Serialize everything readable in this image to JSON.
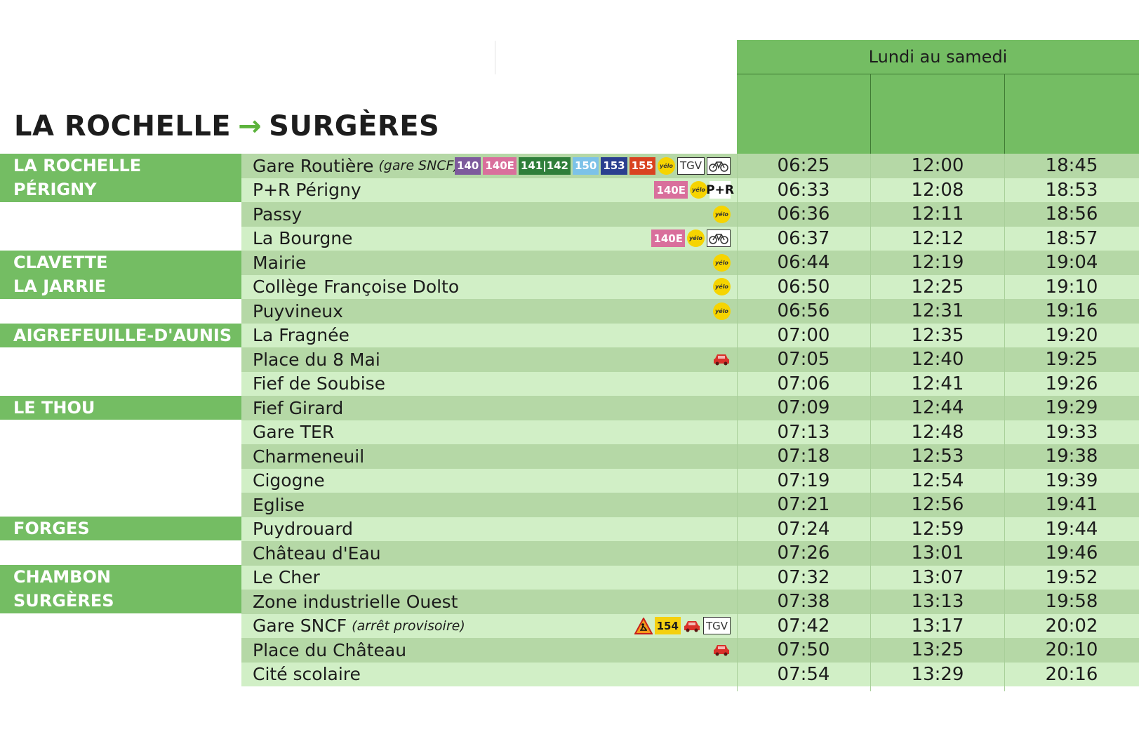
{
  "route": {
    "from": "LA ROCHELLE",
    "arrow": "→",
    "to": "SURGÈRES"
  },
  "header": {
    "days": "Lundi au samedi"
  },
  "communes": [
    {
      "label": "LA ROCHELLE"
    },
    {
      "label": "PÉRIGNY"
    },
    {
      "label": "CLAVETTE"
    },
    {
      "label": "LA JARRIE"
    },
    {
      "label": "AIGREFEUILLE-D'AUNIS"
    },
    {
      "label": "LE THOU"
    },
    {
      "label": "FORGES"
    },
    {
      "label": "CHAMBON"
    },
    {
      "label": "SURGÈRES"
    }
  ],
  "badges": {
    "l140": "140",
    "l140e": "140E",
    "l141": "141",
    "l142": "142",
    "l150": "150",
    "l153": "153",
    "l155": "155",
    "l154": "154",
    "tgv": "TGV",
    "yelo": "yélo",
    "pr": "P+R"
  },
  "icon_names": [
    "yelo-icon",
    "tgv-icon",
    "bike-icon",
    "park-and-ride-icon",
    "car-icon",
    "roadworks-icon"
  ],
  "colors": {
    "header_green": "#74bd63",
    "row_dark": "#b5d8a6",
    "row_light": "#d1efc6",
    "arrow_green": "#5cb33c"
  },
  "stops": [
    {
      "name": "Gare Routière",
      "note": "(gare SNCF)",
      "times": [
        "06:25",
        "12:00",
        "18:45"
      ]
    },
    {
      "name": "P+R Périgny",
      "times": [
        "06:33",
        "12:08",
        "18:53"
      ]
    },
    {
      "name": "Passy",
      "times": [
        "06:36",
        "12:11",
        "18:56"
      ]
    },
    {
      "name": "La Bourgne",
      "times": [
        "06:37",
        "12:12",
        "18:57"
      ]
    },
    {
      "name": "Mairie",
      "times": [
        "06:44",
        "12:19",
        "19:04"
      ]
    },
    {
      "name": "Collège Françoise Dolto",
      "times": [
        "06:50",
        "12:25",
        "19:10"
      ]
    },
    {
      "name": "Puyvineux",
      "times": [
        "06:56",
        "12:31",
        "19:16"
      ]
    },
    {
      "name": "La Fragnée",
      "times": [
        "07:00",
        "12:35",
        "19:20"
      ]
    },
    {
      "name": "Place du 8 Mai",
      "times": [
        "07:05",
        "12:40",
        "19:25"
      ]
    },
    {
      "name": "Fief de Soubise",
      "times": [
        "07:06",
        "12:41",
        "19:26"
      ]
    },
    {
      "name": "Fief Girard",
      "times": [
        "07:09",
        "12:44",
        "19:29"
      ]
    },
    {
      "name": "Gare TER",
      "times": [
        "07:13",
        "12:48",
        "19:33"
      ]
    },
    {
      "name": "Charmeneuil",
      "times": [
        "07:18",
        "12:53",
        "19:38"
      ]
    },
    {
      "name": "Cigogne",
      "times": [
        "07:19",
        "12:54",
        "19:39"
      ]
    },
    {
      "name": "Eglise",
      "times": [
        "07:21",
        "12:56",
        "19:41"
      ]
    },
    {
      "name": "Puydrouard",
      "times": [
        "07:24",
        "12:59",
        "19:44"
      ]
    },
    {
      "name": "Château d'Eau",
      "times": [
        "07:26",
        "13:01",
        "19:46"
      ]
    },
    {
      "name": "Le Cher",
      "times": [
        "07:32",
        "13:07",
        "19:52"
      ]
    },
    {
      "name": "Zone industrielle Ouest",
      "times": [
        "07:38",
        "13:13",
        "19:58"
      ]
    },
    {
      "name": "Gare SNCF",
      "note": "(arrêt provisoire)",
      "times": [
        "07:42",
        "13:17",
        "20:02"
      ]
    },
    {
      "name": "Place du Château",
      "times": [
        "07:50",
        "13:25",
        "20:10"
      ]
    },
    {
      "name": "Cité scolaire",
      "times": [
        "07:54",
        "13:29",
        "20:16"
      ]
    }
  ]
}
